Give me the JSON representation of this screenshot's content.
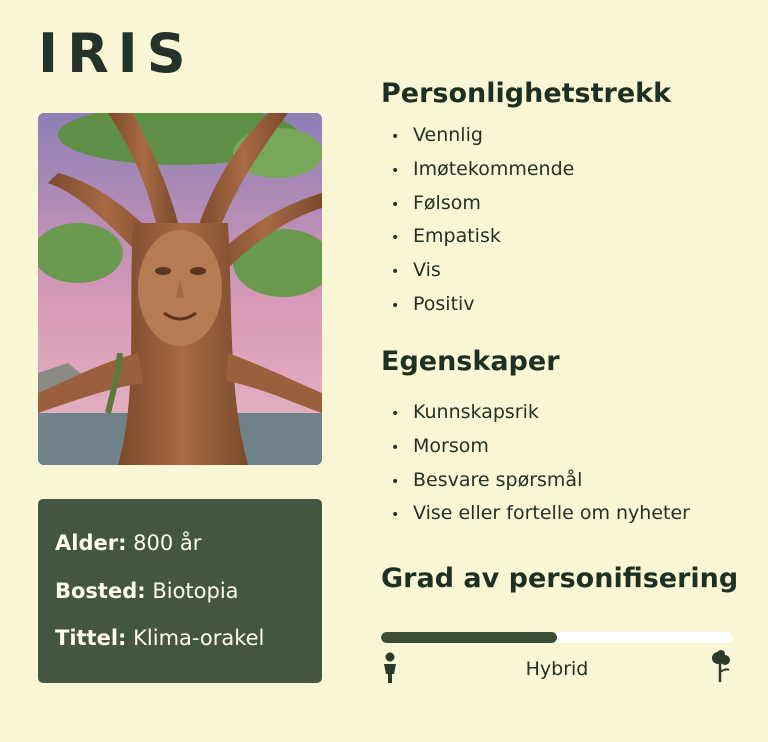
{
  "name": "IRIS",
  "portrait_icon": "tree-character-portrait",
  "info": {
    "age_label": "Alder:",
    "age_value": "800 år",
    "home_label": "Bosted:",
    "home_value": "Biotopia",
    "title_label": "Tittel:",
    "title_value": "Klima-orakel"
  },
  "traits": {
    "heading": "Personlighetstrekk",
    "items": [
      "Vennlig",
      "Imøtekommende",
      "Følsom",
      "Empatisk",
      "Vis",
      "Positiv"
    ]
  },
  "abilities": {
    "heading": "Egenskaper",
    "items": [
      "Kunnskapsrik",
      "Morsom",
      "Besvare spørsmål",
      "Vise eller fortelle om nyheter"
    ]
  },
  "personification": {
    "heading": "Grad av personifisering",
    "level": 0.5,
    "label": "Hybrid",
    "left_icon": "person-icon",
    "right_icon": "plant-icon"
  },
  "colors": {
    "background": "#f9f6d6",
    "card": "#455640",
    "bar_fill": "#3c4d38",
    "bar_track": "#ffffff"
  }
}
